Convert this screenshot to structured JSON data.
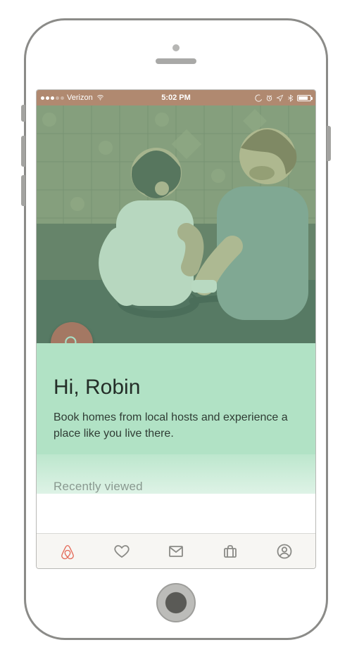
{
  "statusbar": {
    "carrier": "Verizon",
    "time": "5:02 PM",
    "signal_filled": 3,
    "signal_total": 5
  },
  "hero": {
    "search_icon_name": "search-icon"
  },
  "welcome": {
    "greeting": "Hi, Robin",
    "tagline": "Book homes from local hosts and experience a place like you live there."
  },
  "sections": {
    "recently_viewed_label": "Recently viewed"
  },
  "tabs": {
    "explore": "explore",
    "wishlist": "wishlist",
    "inbox": "inbox",
    "trips": "trips",
    "profile": "profile"
  },
  "colors": {
    "brand": "#e46a59",
    "mint": "#a0dcb8",
    "fab": "#a47863"
  }
}
